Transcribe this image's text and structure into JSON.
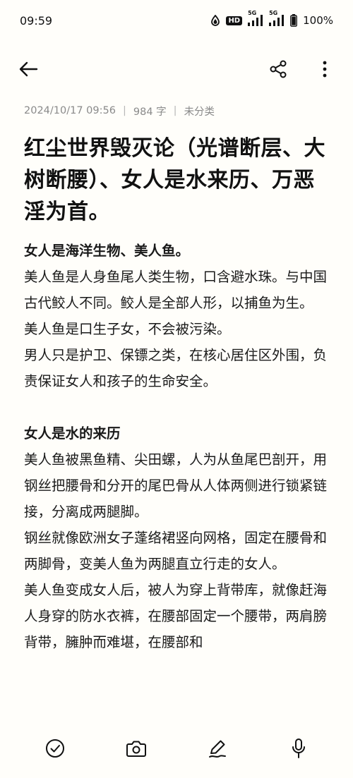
{
  "status": {
    "time": "09:59",
    "battery": "100%",
    "hd_label": "HD",
    "net1": "5G",
    "net2": "5G"
  },
  "note": {
    "date": "2024/10/17 09:56",
    "word_count": "984 字",
    "category": "未分类",
    "title": "红尘世界毁灭论（光谱断层、大树断腰）、女人是水来历、万恶淫为首。",
    "paragraphs": [
      {
        "text": "女人是海洋生物、美人鱼。",
        "bold": true
      },
      {
        "text": "美人鱼是人身鱼尾人类生物，口含避水珠。与中国古代鲛人不同。鲛人是全部人形，以捕鱼为生。",
        "bold": false
      },
      {
        "text": "美人鱼是口生子女，不会被污染。",
        "bold": false
      },
      {
        "text": "男人只是护卫、保镖之类，在核心居住区外围，负责保证女人和孩子的生命安全。",
        "bold": false
      },
      {
        "text": "",
        "bold": false
      },
      {
        "text": "女人是水的来历",
        "bold": true
      },
      {
        "text": "美人鱼被黑鱼精、尖田螺，人为从鱼尾巴剖开，用钢丝把腰骨和分开的尾巴骨从人体两侧进行锁紧链接，分离成两腿脚。",
        "bold": false
      },
      {
        "text": "钢丝就像欧洲女子蓬络裙竖向网格，固定在腰骨和两脚骨，变美人鱼为两腿直立行走的女人。",
        "bold": false
      },
      {
        "text": "美人鱼变成女人后，被人为穿上背带库，就像赶海人身穿的防水衣裤，在腰部固定一个腰带，两肩膀背带，臃肿而难堪，在腰部和",
        "bold": false
      }
    ]
  },
  "icons": {
    "back": "arrow-left-icon",
    "share": "share-icon",
    "more": "more-vertical-icon",
    "check": "check-circle-icon",
    "camera": "camera-icon",
    "edit": "pen-icon",
    "mic": "microphone-icon"
  }
}
